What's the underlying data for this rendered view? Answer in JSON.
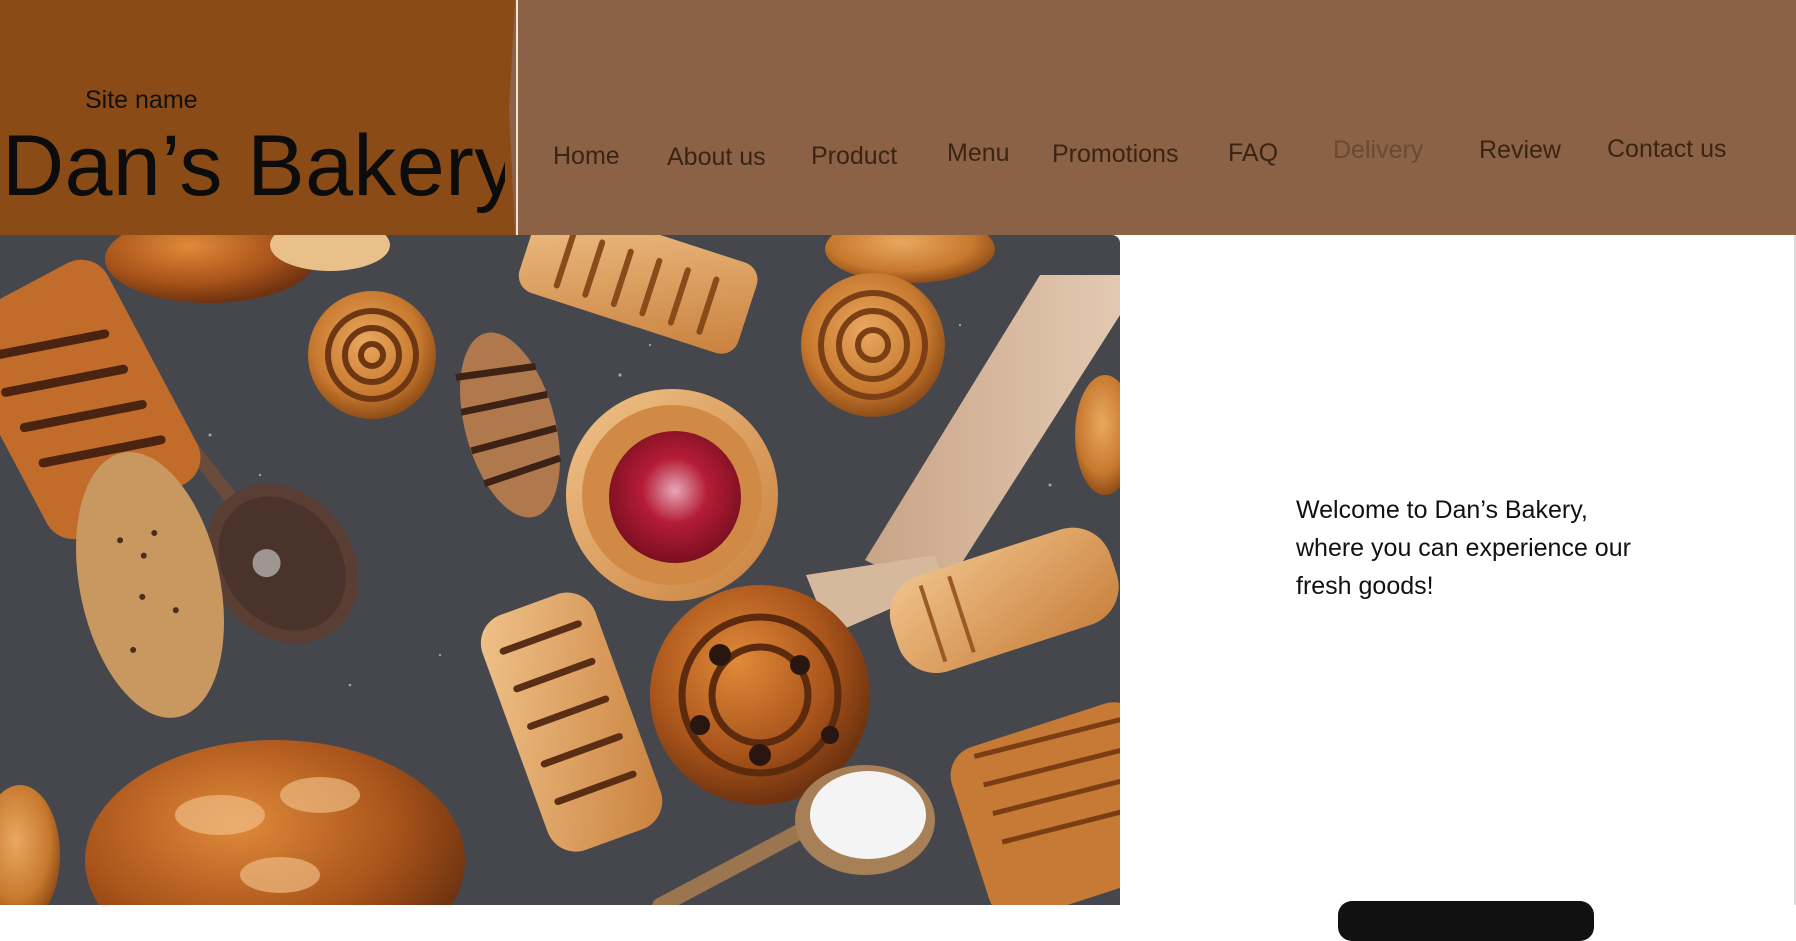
{
  "site": {
    "label": "Site name",
    "title": "Dan’s Bakery"
  },
  "nav": {
    "items": [
      {
        "label": "Home"
      },
      {
        "label": "About us"
      },
      {
        "label": "Product"
      },
      {
        "label": "Menu"
      },
      {
        "label": "Promotions"
      },
      {
        "label": "FAQ"
      },
      {
        "label": "Delivery"
      },
      {
        "label": "Review"
      },
      {
        "label": "Contact us"
      }
    ]
  },
  "hero": {
    "welcome_text": "Welcome to Dan’s Bakery, where you can experience our fresh goods!"
  },
  "colors": {
    "brand_background": "#8a4b17",
    "nav_background": "#8b6245",
    "nav_text": "#3b2413",
    "nav_text_muted": "#6a4a32",
    "page_background": "#ffffff"
  }
}
